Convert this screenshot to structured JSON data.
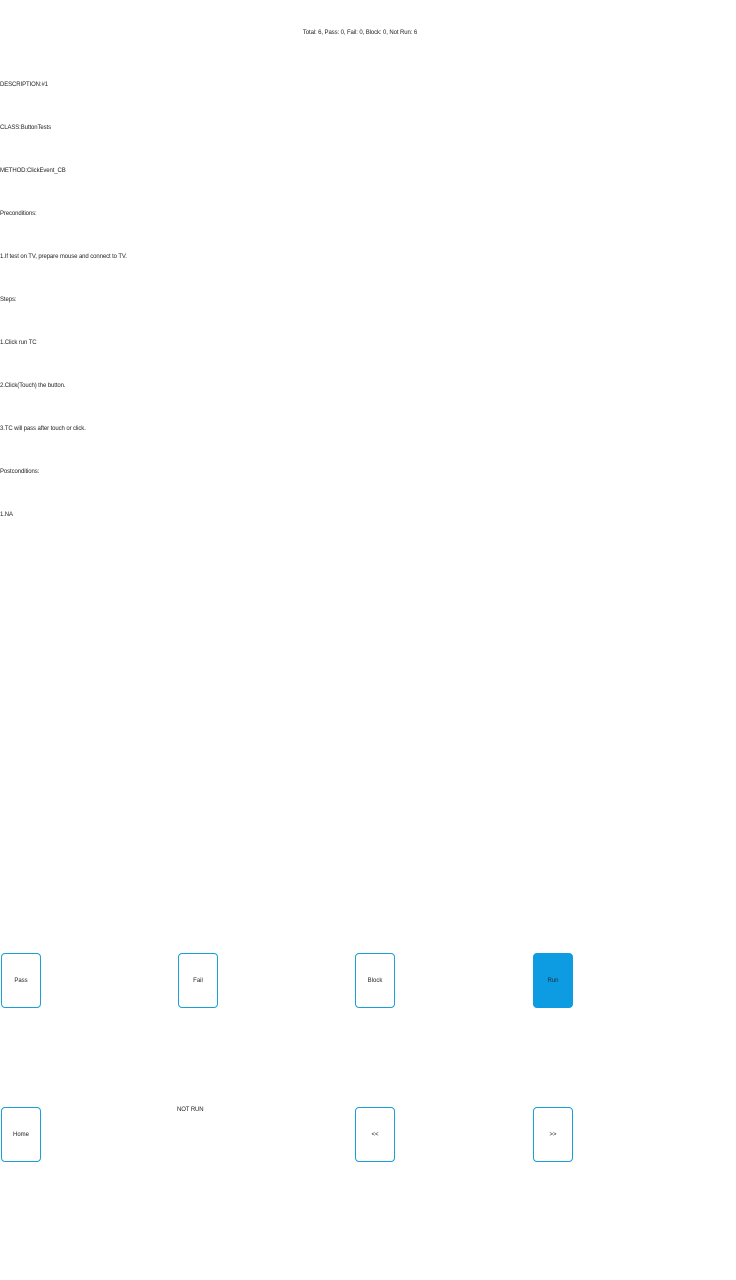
{
  "summary": "Total: 6, Pass: 0, Fail: 0, Block: 0, Not Run: 6",
  "details": {
    "description": "DESCRIPTION:#1",
    "class": "CLASS:ButtonTests",
    "method": "METHOD:ClickEvent_CB",
    "preconditions_label": "Preconditions:",
    "precondition_1": "1.If test on TV, prepare mouse and connect to TV.",
    "steps_label": "Steps:",
    "step_1": "1.Click run TC",
    "step_2": "2.Click(Touch) the button.",
    "step_3": "3.TC will pass after touch or click.",
    "postconditions_label": "Postconditions:",
    "postcondition_1": "1.NA"
  },
  "actions": {
    "pass": "Pass",
    "fail": "Fail",
    "block": "Block",
    "run": "Run"
  },
  "navigation": {
    "home": "Home",
    "prev": "<<",
    "next": ">>"
  },
  "status": "NOT RUN",
  "colors": {
    "accent": "#0d9be1",
    "border": "#1a9fd6"
  }
}
